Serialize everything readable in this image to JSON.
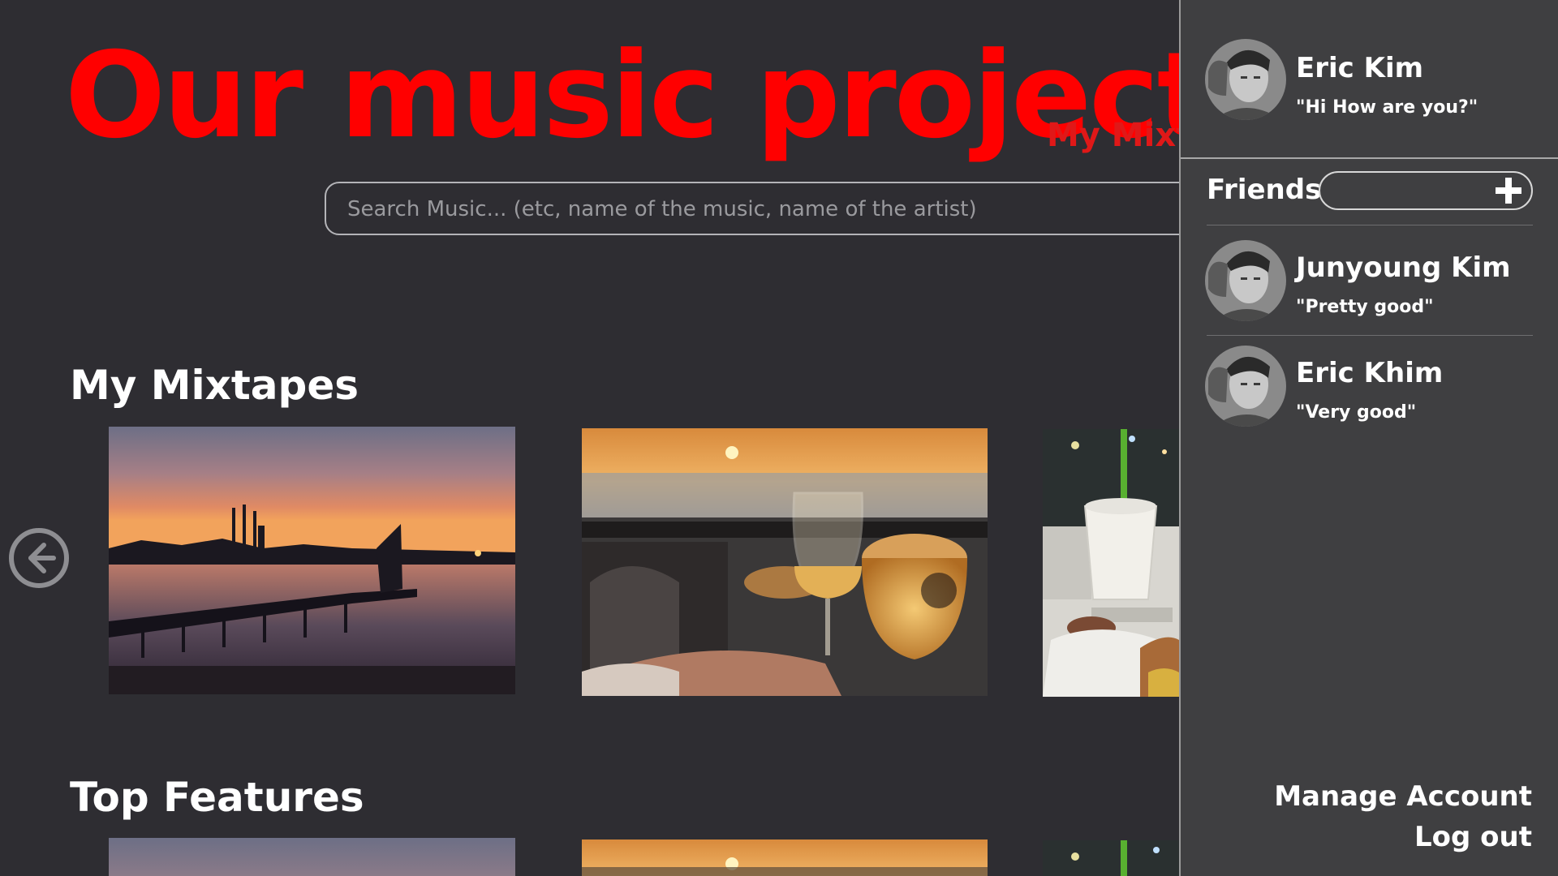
{
  "app": {
    "title": "Our music project",
    "nav_link": "My Mixtapes"
  },
  "search": {
    "placeholder": "Search Music... (etc, name of the music, name of the artist)",
    "value": ""
  },
  "sections": {
    "my_mixtapes": {
      "title": "My Mixtapes",
      "items": [
        "sunset-pier-photo",
        "drinks-toast-photo",
        "shake-cup-photo"
      ]
    },
    "top_features": {
      "title": "Top Features",
      "items": [
        "sunset-pier-photo",
        "drinks-toast-photo",
        "shake-cup-photo"
      ]
    }
  },
  "sidebar": {
    "profile": {
      "name": "Eric Kim",
      "status": "\"Hi How are you?\""
    },
    "friends_label": "Friends",
    "friend_search_value": "",
    "friends": [
      {
        "name": "Junyoung Kim",
        "status": "\"Pretty good\""
      },
      {
        "name": "Eric Khim",
        "status": "\"Very good\""
      }
    ],
    "manage_account": "Manage Account",
    "log_out": "Log out"
  },
  "icons": {
    "prev": "arrow-left-circle-icon",
    "add": "plus-icon"
  },
  "colors": {
    "background": "#2e2d32",
    "sidebar": "#3f3f41",
    "title": "#ff0000",
    "text": "#ffffff"
  }
}
